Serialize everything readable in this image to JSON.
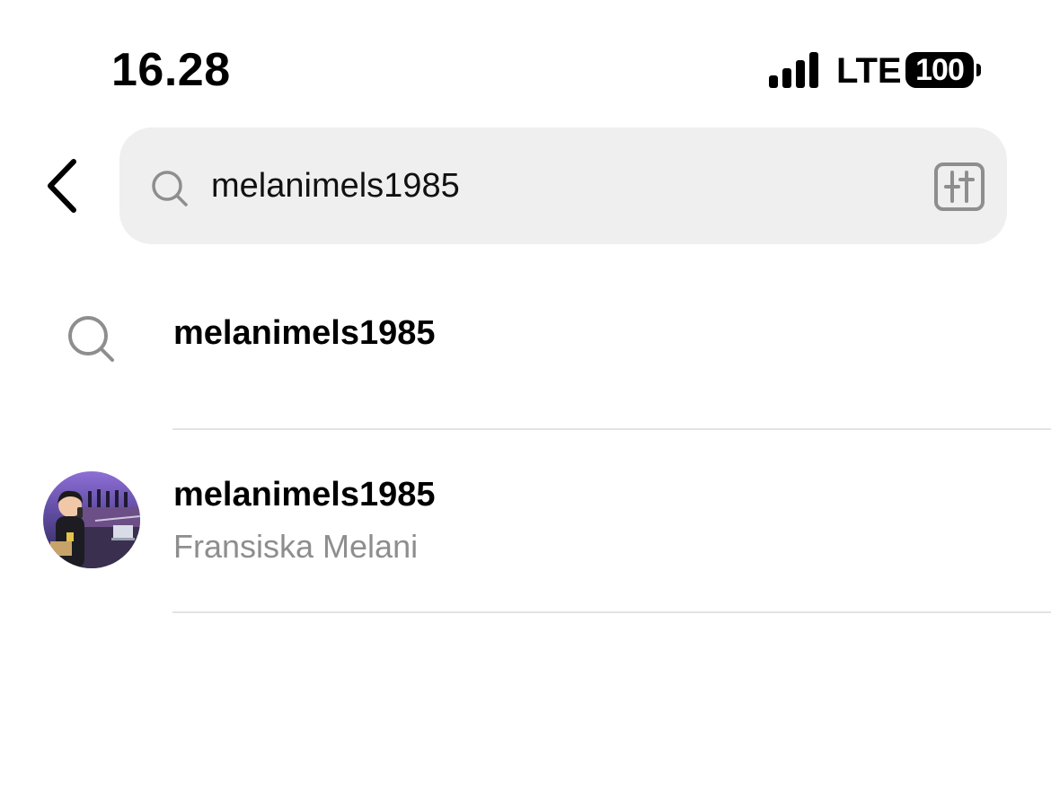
{
  "status_bar": {
    "time": "16.28",
    "network": "LTE",
    "battery": "100"
  },
  "search": {
    "value": "melanimels1985",
    "icons": {
      "back": "chevron-left-icon",
      "search": "search-icon",
      "filter": "filter-icon"
    }
  },
  "results": {
    "query_suggestion": {
      "label": "melanimels1985",
      "icon": "search-icon"
    },
    "user": {
      "username": "melanimels1985",
      "full_name": "Fransiska Melani",
      "icon": "avatar"
    }
  },
  "colors": {
    "search_bg": "#efefef",
    "secondary_text": "#8e8e8e",
    "divider": "#e3e3e3"
  }
}
